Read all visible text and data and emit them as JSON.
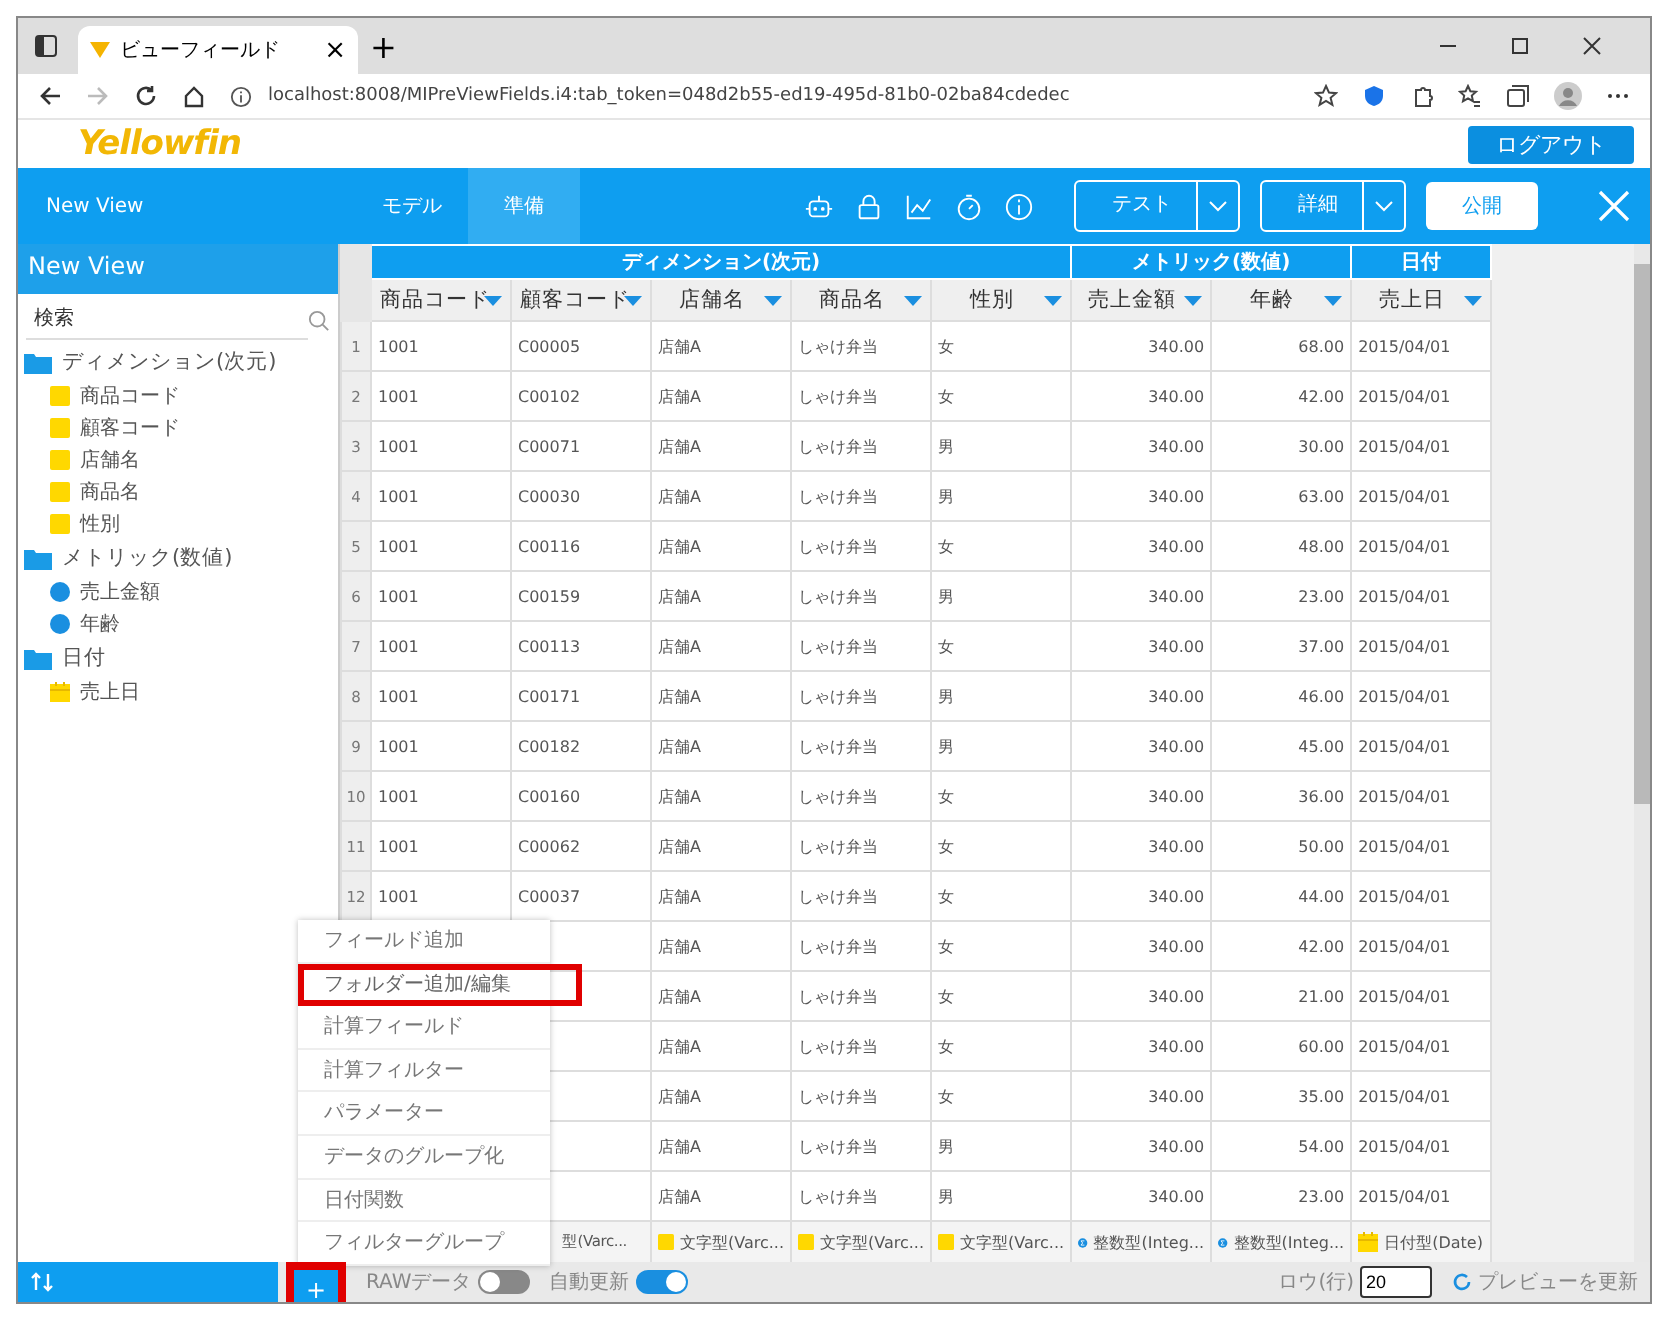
{
  "browser": {
    "tab_title": "ビューフィールド",
    "tab_close": "×",
    "new_tab": "+",
    "url": "localhost:8008/MIPreViewFields.i4:tab_token=048d2b55-ed19-495d-81b0-02ba84cdedec"
  },
  "header": {
    "logo": "Yellowfin",
    "logout": "ログアウト"
  },
  "nav": {
    "title": "New View",
    "tabs": [
      {
        "label": "モデル",
        "selected": false
      },
      {
        "label": "準備",
        "selected": true
      }
    ],
    "test": "テスト",
    "detail": "詳細",
    "publish": "公開"
  },
  "sidebar": {
    "title": "New View",
    "search": {
      "placeholder": "検索"
    },
    "folders": [
      {
        "label": "ディメンション(次元)",
        "children": [
          {
            "label": "商品コード",
            "kind": "text"
          },
          {
            "label": "顧客コード",
            "kind": "text"
          },
          {
            "label": "店舗名",
            "kind": "text"
          },
          {
            "label": "商品名",
            "kind": "text"
          },
          {
            "label": "性別",
            "kind": "text"
          }
        ]
      },
      {
        "label": "メトリック(数値)",
        "children": [
          {
            "label": "売上金額",
            "kind": "number"
          },
          {
            "label": "年齢",
            "kind": "number"
          }
        ]
      },
      {
        "label": "日付",
        "children": [
          {
            "label": "売上日",
            "kind": "date"
          }
        ]
      }
    ]
  },
  "table": {
    "groups": [
      {
        "label": "ディメンション(次元)",
        "columns": [
          {
            "label": "商品コード",
            "kind": "text"
          },
          {
            "label": "顧客コード",
            "kind": "text",
            "type_label": "型(Varc..."
          },
          {
            "label": "店舗名",
            "kind": "text",
            "type_label": "文字型(Varc..."
          },
          {
            "label": "商品名",
            "kind": "text",
            "type_label": "文字型(Varc..."
          },
          {
            "label": "性別",
            "kind": "text",
            "type_label": "文字型(Varc..."
          }
        ]
      },
      {
        "label": "メトリック(数値)",
        "columns": [
          {
            "label": "売上金額",
            "kind": "number",
            "type_label": "整数型(Integ..."
          },
          {
            "label": "年齢",
            "kind": "number",
            "type_label": "整数型(Integ..."
          }
        ]
      },
      {
        "label": "日付",
        "columns": [
          {
            "label": "売上日",
            "kind": "date",
            "type_label": "日付型(Date)"
          }
        ]
      }
    ],
    "rows": [
      {
        "number": "1",
        "product_code": "1001",
        "customer_code": "C00005",
        "store": "店舗A",
        "product": "しゃけ弁当",
        "gender": "女",
        "sales": "340.00",
        "age": "68.00",
        "date": "2015/04/01"
      },
      {
        "number": "2",
        "product_code": "1001",
        "customer_code": "C00102",
        "store": "店舗A",
        "product": "しゃけ弁当",
        "gender": "女",
        "sales": "340.00",
        "age": "42.00",
        "date": "2015/04/01"
      },
      {
        "number": "3",
        "product_code": "1001",
        "customer_code": "C00071",
        "store": "店舗A",
        "product": "しゃけ弁当",
        "gender": "男",
        "sales": "340.00",
        "age": "30.00",
        "date": "2015/04/01"
      },
      {
        "number": "4",
        "product_code": "1001",
        "customer_code": "C00030",
        "store": "店舗A",
        "product": "しゃけ弁当",
        "gender": "男",
        "sales": "340.00",
        "age": "63.00",
        "date": "2015/04/01"
      },
      {
        "number": "5",
        "product_code": "1001",
        "customer_code": "C00116",
        "store": "店舗A",
        "product": "しゃけ弁当",
        "gender": "女",
        "sales": "340.00",
        "age": "48.00",
        "date": "2015/04/01"
      },
      {
        "number": "6",
        "product_code": "1001",
        "customer_code": "C00159",
        "store": "店舗A",
        "product": "しゃけ弁当",
        "gender": "男",
        "sales": "340.00",
        "age": "23.00",
        "date": "2015/04/01"
      },
      {
        "number": "7",
        "product_code": "1001",
        "customer_code": "C00113",
        "store": "店舗A",
        "product": "しゃけ弁当",
        "gender": "女",
        "sales": "340.00",
        "age": "37.00",
        "date": "2015/04/01"
      },
      {
        "number": "8",
        "product_code": "1001",
        "customer_code": "C00171",
        "store": "店舗A",
        "product": "しゃけ弁当",
        "gender": "男",
        "sales": "340.00",
        "age": "46.00",
        "date": "2015/04/01"
      },
      {
        "number": "9",
        "product_code": "1001",
        "customer_code": "C00182",
        "store": "店舗A",
        "product": "しゃけ弁当",
        "gender": "男",
        "sales": "340.00",
        "age": "45.00",
        "date": "2015/04/01"
      },
      {
        "number": "10",
        "product_code": "1001",
        "customer_code": "C00160",
        "store": "店舗A",
        "product": "しゃけ弁当",
        "gender": "女",
        "sales": "340.00",
        "age": "36.00",
        "date": "2015/04/01"
      },
      {
        "number": "11",
        "product_code": "1001",
        "customer_code": "C00062",
        "store": "店舗A",
        "product": "しゃけ弁当",
        "gender": "女",
        "sales": "340.00",
        "age": "50.00",
        "date": "2015/04/01"
      },
      {
        "number": "12",
        "product_code": "1001",
        "customer_code": "C00037",
        "store": "店舗A",
        "product": "しゃけ弁当",
        "gender": "女",
        "sales": "340.00",
        "age": "44.00",
        "date": "2015/04/01"
      },
      {
        "store": "店舗A",
        "product": "しゃけ弁当",
        "gender": "女",
        "sales": "340.00",
        "age": "42.00",
        "date": "2015/04/01"
      },
      {
        "store": "店舗A",
        "product": "しゃけ弁当",
        "gender": "女",
        "sales": "340.00",
        "age": "21.00",
        "date": "2015/04/01"
      },
      {
        "store": "店舗A",
        "product": "しゃけ弁当",
        "gender": "女",
        "sales": "340.00",
        "age": "60.00",
        "date": "2015/04/01"
      },
      {
        "store": "店舗A",
        "product": "しゃけ弁当",
        "gender": "女",
        "sales": "340.00",
        "age": "35.00",
        "date": "2015/04/01"
      },
      {
        "store": "店舗A",
        "product": "しゃけ弁当",
        "gender": "男",
        "sales": "340.00",
        "age": "54.00",
        "date": "2015/04/01"
      },
      {
        "store": "店舗A",
        "product": "しゃけ弁当",
        "gender": "男",
        "sales": "340.00",
        "age": "23.00",
        "date": "2015/04/01"
      }
    ]
  },
  "add_menu": {
    "items": [
      {
        "label": "フィールド追加",
        "highlighted": false
      },
      {
        "label": "フォルダー追加/編集",
        "highlighted": true
      },
      {
        "label": "計算フィールド",
        "highlighted": false
      },
      {
        "label": "計算フィルター",
        "highlighted": false
      },
      {
        "label": "パラメーター",
        "highlighted": false
      },
      {
        "label": "データのグループ化",
        "highlighted": false
      },
      {
        "label": "日付関数",
        "highlighted": false
      },
      {
        "label": "フィルターグループ",
        "highlighted": false
      }
    ]
  },
  "footer": {
    "add_button": {
      "label": "+",
      "highlighted": true
    },
    "toggles": [
      {
        "label": "RAWデータ",
        "on": false
      },
      {
        "label": "自動更新",
        "on": true
      }
    ],
    "rows_label": "ロウ(行)",
    "rows_value": "20",
    "refresh": "プレビューを更新"
  }
}
